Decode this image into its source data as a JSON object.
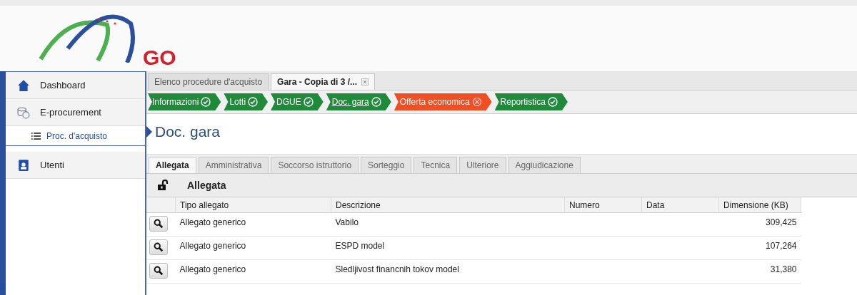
{
  "logo": {
    "text": "GO"
  },
  "sidebar": {
    "items": [
      {
        "label": "Dashboard",
        "kind": "home",
        "selected": false
      },
      {
        "label": "E-procurement",
        "kind": "coins",
        "selected": false,
        "children": [
          {
            "label": "Proc. d'acquisto",
            "kind": "list",
            "selected": true
          }
        ]
      },
      {
        "label": "Utenti",
        "kind": "user",
        "selected": false
      }
    ]
  },
  "doc_tabs": [
    {
      "label": "Elenco procedure d'acquisto",
      "selected": false,
      "kind": "plain"
    },
    {
      "label": "Gara - Copia di 3 /...",
      "selected": true,
      "kind": "closable"
    }
  ],
  "steps": [
    {
      "label": "Informazioni",
      "kind": "done",
      "selected": false
    },
    {
      "label": "Lotti",
      "kind": "done",
      "selected": false
    },
    {
      "label": "DGUE",
      "kind": "done",
      "selected": false
    },
    {
      "label": "Doc. gara",
      "kind": "done",
      "selected": true
    },
    {
      "label": "Offerta economica",
      "kind": "error",
      "selected": false
    },
    {
      "label": "Reportistica",
      "kind": "done",
      "selected": false
    }
  ],
  "page_title": "Doc. gara",
  "tabs": [
    {
      "label": "Allegata",
      "selected": true
    },
    {
      "label": "Amministrativa",
      "selected": false
    },
    {
      "label": "Soccorso istruttorio",
      "selected": false
    },
    {
      "label": "Sorteggio",
      "selected": false
    },
    {
      "label": "Tecnica",
      "selected": false
    },
    {
      "label": "Ulteriore",
      "selected": false
    },
    {
      "label": "Aggiudicazione",
      "selected": false
    }
  ],
  "section": {
    "title": "Allegata",
    "locked": false
  },
  "table": {
    "columns": [
      "Tipo allegato",
      "Descrizione",
      "Numero",
      "Data",
      "Dimensione (KB)"
    ],
    "rows": [
      [
        "Allegato generico",
        "Vabilo",
        "",
        "",
        "309,425"
      ],
      [
        "Allegato generico",
        "ESPD model",
        "",
        "",
        "107,264"
      ],
      [
        "Allegato generico",
        "Sledljivost financnih tokov model",
        "",
        "",
        "31,380"
      ]
    ]
  }
}
